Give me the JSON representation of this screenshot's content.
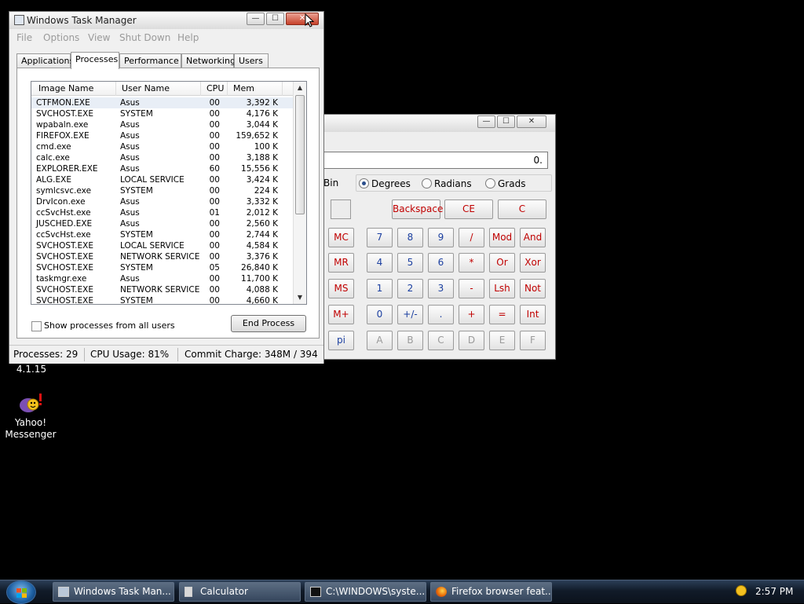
{
  "desktop": {
    "version_text": "4.1.15",
    "yahoo_label_line1": "Yahoo!",
    "yahoo_label_line2": "Messenger"
  },
  "task_manager": {
    "title": "Windows Task Manager",
    "controls": {
      "minimize": "—",
      "maximize": "☐",
      "close": "✕"
    },
    "menu": [
      "File",
      "Options",
      "View",
      "Shut Down",
      "Help"
    ],
    "tabs": [
      "Applications",
      "Processes",
      "Performance",
      "Networking",
      "Users"
    ],
    "active_tab": "Processes",
    "columns": [
      "Image Name",
      "User Name",
      "CPU",
      "Mem Usage"
    ],
    "processes": [
      {
        "image": "CTFMON.EXE",
        "user": "Asus",
        "cpu": "00",
        "mem": "3,392 K"
      },
      {
        "image": "SVCHOST.EXE",
        "user": "SYSTEM",
        "cpu": "00",
        "mem": "4,176 K"
      },
      {
        "image": "wpabaln.exe",
        "user": "Asus",
        "cpu": "00",
        "mem": "3,044 K"
      },
      {
        "image": "FIREFOX.EXE",
        "user": "Asus",
        "cpu": "00",
        "mem": "159,652 K"
      },
      {
        "image": "cmd.exe",
        "user": "Asus",
        "cpu": "00",
        "mem": "100 K"
      },
      {
        "image": "calc.exe",
        "user": "Asus",
        "cpu": "00",
        "mem": "3,188 K"
      },
      {
        "image": "EXPLORER.EXE",
        "user": "Asus",
        "cpu": "60",
        "mem": "15,556 K"
      },
      {
        "image": "ALG.EXE",
        "user": "LOCAL SERVICE",
        "cpu": "00",
        "mem": "3,424 K"
      },
      {
        "image": "symlcsvc.exe",
        "user": "SYSTEM",
        "cpu": "00",
        "mem": "224 K"
      },
      {
        "image": "DrvIcon.exe",
        "user": "Asus",
        "cpu": "00",
        "mem": "3,332 K"
      },
      {
        "image": "ccSvcHst.exe",
        "user": "Asus",
        "cpu": "01",
        "mem": "2,012 K"
      },
      {
        "image": "JUSCHED.EXE",
        "user": "Asus",
        "cpu": "00",
        "mem": "2,560 K"
      },
      {
        "image": "ccSvcHst.exe",
        "user": "SYSTEM",
        "cpu": "00",
        "mem": "2,744 K"
      },
      {
        "image": "SVCHOST.EXE",
        "user": "LOCAL SERVICE",
        "cpu": "00",
        "mem": "4,584 K"
      },
      {
        "image": "SVCHOST.EXE",
        "user": "NETWORK SERVICE",
        "cpu": "00",
        "mem": "3,376 K"
      },
      {
        "image": "SVCHOST.EXE",
        "user": "SYSTEM",
        "cpu": "05",
        "mem": "26,840 K"
      },
      {
        "image": "taskmgr.exe",
        "user": "Asus",
        "cpu": "00",
        "mem": "11,700 K"
      },
      {
        "image": "SVCHOST.EXE",
        "user": "NETWORK SERVICE",
        "cpu": "00",
        "mem": "4,088 K"
      },
      {
        "image": "SVCHOST.EXE",
        "user": "SYSTEM",
        "cpu": "00",
        "mem": "4,660 K"
      }
    ],
    "show_all_label": "Show processes from all users",
    "end_process_label": "End Process",
    "status": {
      "processes": "Processes: 29",
      "cpu": "CPU Usage: 81%",
      "commit": "Commit Charge: 348M / 394"
    }
  },
  "calculator": {
    "controls": {
      "minimize": "—",
      "maximize": "☐",
      "close": "✕"
    },
    "display_value": "0.",
    "bin_fragment": "Bin",
    "angle_options": [
      "Degrees",
      "Radians",
      "Grads"
    ],
    "selected_angle": "Degrees",
    "buttons": {
      "backspace": "Backspace",
      "ce": "CE",
      "c": "C",
      "mc": "MC",
      "mr": "MR",
      "ms": "MS",
      "mplus": "M+",
      "pi": "pi",
      "d7": "7",
      "d8": "8",
      "d9": "9",
      "div": "/",
      "mod": "Mod",
      "and": "And",
      "d4": "4",
      "d5": "5",
      "d6": "6",
      "mul": "*",
      "or": "Or",
      "xor": "Xor",
      "d1": "1",
      "d2": "2",
      "d3": "3",
      "sub": "-",
      "lsh": "Lsh",
      "not": "Not",
      "d0": "0",
      "sign": "+/-",
      "dot": ".",
      "add": "+",
      "eq": "=",
      "int": "Int",
      "hA": "A",
      "hB": "B",
      "hC": "C",
      "hD": "D",
      "hE": "E",
      "hF": "F"
    }
  },
  "taskbar": {
    "items": [
      {
        "label": "Windows Task Man..."
      },
      {
        "label": "Calculator"
      },
      {
        "label": "C:\\WINDOWS\\syste..."
      },
      {
        "label": "Firefox browser feat..."
      }
    ],
    "clock": "2:57 PM"
  }
}
